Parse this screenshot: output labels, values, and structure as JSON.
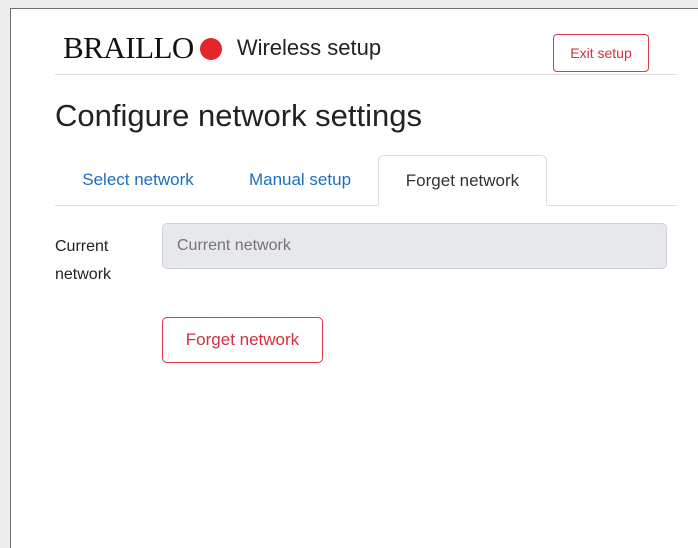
{
  "header": {
    "logo_text": "BRAILLO",
    "app_title": "Wireless setup",
    "exit_label": "Exit setup"
  },
  "page": {
    "title": "Configure network settings"
  },
  "tabs": [
    {
      "label": "Select network",
      "active": false
    },
    {
      "label": "Manual setup",
      "active": false
    },
    {
      "label": "Forget network",
      "active": true
    }
  ],
  "form": {
    "current_network_label": "Current network",
    "current_network_placeholder": "Current network",
    "current_network_value": "",
    "forget_button_label": "Forget network"
  },
  "colors": {
    "brand_red": "#e5242b",
    "link_blue": "#1a6fc4",
    "danger": "#d03040",
    "disabled_input_bg": "#e6e8eb"
  }
}
